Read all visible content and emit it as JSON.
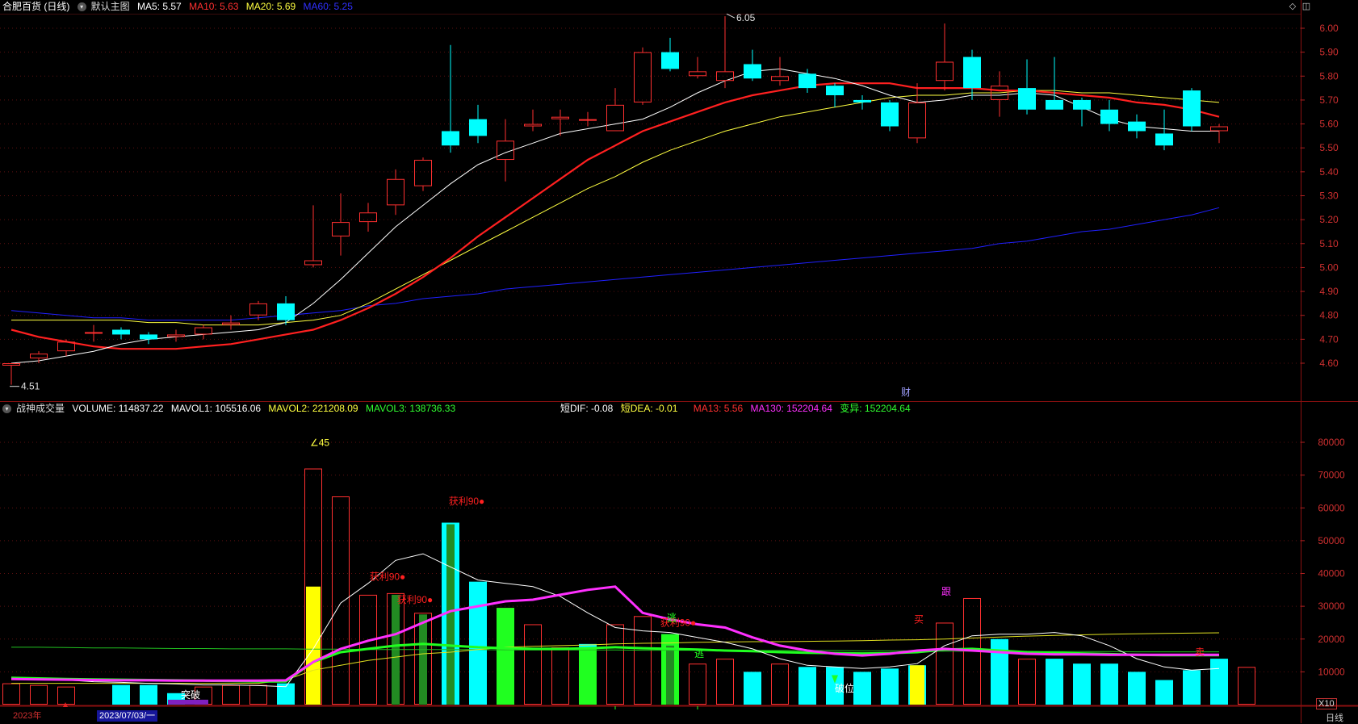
{
  "main_header": {
    "title": "合肥百货 (日线)",
    "formula": "默认主图",
    "ma5": "MA5: 5.57",
    "ma10": "MA10: 5.63",
    "ma20": "MA20: 5.69",
    "ma60": "MA60: 5.25"
  },
  "sub_header": {
    "title": "战神成交量",
    "volume": "VOLUME: 114837.22",
    "mavol1": "MAVOL1: 105516.06",
    "mavol2": "MAVOL2: 221208.09",
    "mavol3": "MAVOL3: 138736.33",
    "dif": "短DIF: -0.08",
    "dea": "短DEA: -0.01",
    "ma13": "MA13: 5.56",
    "ma130": "MA130: 152204.64",
    "change": "变异: 152204.64"
  },
  "colors": {
    "up": "#ff3030",
    "down": "#00ffff",
    "ma5": "#ffffff",
    "ma10": "#ff2020",
    "ma20": "#ffff40",
    "ma60": "#2020ff",
    "purple": "#ff30ff",
    "green": "#20ff20",
    "yellow": "#ffff00",
    "darkgreen": "#228b22"
  },
  "price_axis": [
    "6.00",
    "5.90",
    "5.80",
    "5.70",
    "5.60",
    "5.50",
    "5.40",
    "5.30",
    "5.20",
    "5.10",
    "5.00",
    "4.90",
    "4.80",
    "4.70",
    "4.60"
  ],
  "volume_axis": [
    "80000",
    "70000",
    "60000",
    "50000",
    "40000",
    "30000",
    "20000",
    "10000"
  ],
  "annotations": {
    "high": "6.05",
    "low": "4.51",
    "cai": "财",
    "ratio": "X10",
    "period": "日线",
    "vol_peak": "∠45",
    "year": "2023年",
    "date": "2023/07/03/一"
  },
  "signals": [
    {
      "text": "获利90●",
      "color": "#ff2020"
    },
    {
      "text": "获利90●",
      "color": "#ff2020"
    },
    {
      "text": "获利90●",
      "color": "#ff2020"
    },
    {
      "text": "获利90●",
      "color": "#ff2020"
    },
    {
      "text": "逃",
      "color": "#20ff20"
    },
    {
      "text": "逃",
      "color": "#20ff20"
    },
    {
      "text": "买",
      "color": "#ff2020"
    },
    {
      "text": "跟",
      "color": "#ff30ff"
    },
    {
      "text": "突破",
      "color": "#ffffff"
    },
    {
      "text": "破位",
      "color": "#ffffff"
    },
    {
      "text": "卖",
      "color": "#ff2020"
    }
  ],
  "chart_data": {
    "type": "candlestick",
    "candles": [
      {
        "o": 4.59,
        "c": 4.6,
        "h": 4.6,
        "l": 4.51
      },
      {
        "o": 4.62,
        "c": 4.64,
        "h": 4.65,
        "l": 4.6
      },
      {
        "o": 4.65,
        "c": 4.69,
        "h": 4.7,
        "l": 4.63
      },
      {
        "o": 4.73,
        "c": 4.73,
        "h": 4.76,
        "l": 4.69
      },
      {
        "o": 4.74,
        "c": 4.72,
        "h": 4.75,
        "l": 4.7
      },
      {
        "o": 4.72,
        "c": 4.7,
        "h": 4.73,
        "l": 4.68
      },
      {
        "o": 4.71,
        "c": 4.72,
        "h": 4.74,
        "l": 4.69
      },
      {
        "o": 4.72,
        "c": 4.75,
        "h": 4.76,
        "l": 4.7
      },
      {
        "o": 4.76,
        "c": 4.77,
        "h": 4.8,
        "l": 4.74
      },
      {
        "o": 4.8,
        "c": 4.85,
        "h": 4.86,
        "l": 4.78
      },
      {
        "o": 4.85,
        "c": 4.78,
        "h": 4.88,
        "l": 4.76
      },
      {
        "o": 5.01,
        "c": 5.03,
        "h": 5.26,
        "l": 5.0
      },
      {
        "o": 5.13,
        "c": 5.19,
        "h": 5.31,
        "l": 5.05
      },
      {
        "o": 5.19,
        "c": 5.23,
        "h": 5.27,
        "l": 5.15
      },
      {
        "o": 5.26,
        "c": 5.37,
        "h": 5.41,
        "l": 5.22
      },
      {
        "o": 5.34,
        "c": 5.45,
        "h": 5.46,
        "l": 5.32
      },
      {
        "o": 5.57,
        "c": 5.51,
        "h": 5.93,
        "l": 5.48
      },
      {
        "o": 5.62,
        "c": 5.55,
        "h": 5.68,
        "l": 5.52
      },
      {
        "o": 5.45,
        "c": 5.53,
        "h": 5.62,
        "l": 5.36
      },
      {
        "o": 5.59,
        "c": 5.6,
        "h": 5.66,
        "l": 5.57
      },
      {
        "o": 5.62,
        "c": 5.63,
        "h": 5.66,
        "l": 5.55
      },
      {
        "o": 5.62,
        "c": 5.62,
        "h": 5.65,
        "l": 5.59
      },
      {
        "o": 5.57,
        "c": 5.68,
        "h": 5.75,
        "l": 5.57
      },
      {
        "o": 5.69,
        "c": 5.9,
        "h": 5.92,
        "l": 5.68
      },
      {
        "o": 5.9,
        "c": 5.83,
        "h": 5.96,
        "l": 5.82
      },
      {
        "o": 5.8,
        "c": 5.82,
        "h": 5.88,
        "l": 5.79
      },
      {
        "o": 5.78,
        "c": 5.82,
        "h": 6.05,
        "l": 5.75
      },
      {
        "o": 5.85,
        "c": 5.79,
        "h": 5.91,
        "l": 5.78
      },
      {
        "o": 5.78,
        "c": 5.8,
        "h": 5.88,
        "l": 5.76
      },
      {
        "o": 5.81,
        "c": 5.75,
        "h": 5.83,
        "l": 5.73
      },
      {
        "o": 5.76,
        "c": 5.72,
        "h": 5.77,
        "l": 5.67
      },
      {
        "o": 5.7,
        "c": 5.69,
        "h": 5.72,
        "l": 5.66
      },
      {
        "o": 5.69,
        "c": 5.59,
        "h": 5.7,
        "l": 5.57
      },
      {
        "o": 5.54,
        "c": 5.69,
        "h": 5.77,
        "l": 5.52
      },
      {
        "o": 5.78,
        "c": 5.86,
        "h": 6.02,
        "l": 5.74
      },
      {
        "o": 5.88,
        "c": 5.75,
        "h": 5.91,
        "l": 5.7
      },
      {
        "o": 5.7,
        "c": 5.76,
        "h": 5.82,
        "l": 5.63
      },
      {
        "o": 5.75,
        "c": 5.66,
        "h": 5.87,
        "l": 5.64
      },
      {
        "o": 5.7,
        "c": 5.66,
        "h": 5.88,
        "l": 5.66
      },
      {
        "o": 5.7,
        "c": 5.66,
        "h": 5.71,
        "l": 5.59
      },
      {
        "o": 5.66,
        "c": 5.6,
        "h": 5.7,
        "l": 5.57
      },
      {
        "o": 5.61,
        "c": 5.57,
        "h": 5.64,
        "l": 5.54
      },
      {
        "o": 5.56,
        "c": 5.51,
        "h": 5.66,
        "l": 5.49
      },
      {
        "o": 5.74,
        "c": 5.59,
        "h": 5.75,
        "l": 5.57
      },
      {
        "o": 5.57,
        "c": 5.59,
        "h": 5.6,
        "l": 5.52
      }
    ],
    "ma5": [
      4.6,
      4.61,
      4.63,
      4.65,
      4.68,
      4.7,
      4.71,
      4.72,
      4.73,
      4.74,
      4.77,
      4.85,
      4.95,
      5.06,
      5.17,
      5.26,
      5.35,
      5.43,
      5.48,
      5.52,
      5.56,
      5.58,
      5.6,
      5.62,
      5.67,
      5.73,
      5.78,
      5.82,
      5.83,
      5.81,
      5.79,
      5.76,
      5.72,
      5.69,
      5.7,
      5.72,
      5.72,
      5.73,
      5.72,
      5.67,
      5.62,
      5.59,
      5.58,
      5.57,
      5.57
    ],
    "ma10": [
      4.74,
      4.71,
      4.69,
      4.67,
      4.66,
      4.66,
      4.66,
      4.67,
      4.68,
      4.7,
      4.72,
      4.74,
      4.78,
      4.83,
      4.89,
      4.96,
      5.04,
      5.13,
      5.21,
      5.29,
      5.37,
      5.45,
      5.51,
      5.57,
      5.61,
      5.65,
      5.69,
      5.72,
      5.74,
      5.76,
      5.77,
      5.77,
      5.77,
      5.75,
      5.75,
      5.75,
      5.74,
      5.74,
      5.73,
      5.72,
      5.71,
      5.69,
      5.68,
      5.66,
      5.63
    ],
    "ma20": [
      4.78,
      4.78,
      4.78,
      4.78,
      4.78,
      4.77,
      4.77,
      4.76,
      4.76,
      4.76,
      4.77,
      4.78,
      4.8,
      4.85,
      4.91,
      4.97,
      5.03,
      5.09,
      5.15,
      5.21,
      5.27,
      5.33,
      5.38,
      5.44,
      5.49,
      5.53,
      5.57,
      5.6,
      5.63,
      5.65,
      5.67,
      5.69,
      5.71,
      5.72,
      5.72,
      5.73,
      5.73,
      5.74,
      5.74,
      5.73,
      5.73,
      5.72,
      5.71,
      5.7,
      5.69
    ],
    "ma60": [
      4.82,
      4.81,
      4.8,
      4.79,
      4.79,
      4.78,
      4.78,
      4.78,
      4.78,
      4.79,
      4.8,
      4.81,
      4.82,
      4.84,
      4.85,
      4.87,
      4.88,
      4.89,
      4.91,
      4.92,
      4.93,
      4.94,
      4.95,
      4.96,
      4.97,
      4.98,
      4.99,
      5.0,
      5.01,
      5.02,
      5.03,
      5.04,
      5.05,
      5.06,
      5.07,
      5.08,
      5.1,
      5.11,
      5.13,
      5.15,
      5.16,
      5.18,
      5.2,
      5.22,
      5.25
    ],
    "volume": [
      6500,
      6000,
      5500,
      0,
      6000,
      6000,
      3500,
      5500,
      6000,
      6000,
      6500,
      72000,
      63500,
      33500,
      34000,
      28000,
      55500,
      37500,
      29500,
      24500,
      17500,
      18500,
      24500,
      27000,
      21500,
      12500,
      14000,
      10000,
      12500,
      11500,
      11500,
      10000,
      11000,
      12000,
      25000,
      32500,
      20000,
      14000,
      14000,
      12500,
      12500,
      10000,
      7500,
      10500,
      14000,
      11500
    ],
    "vol_color": [
      "u",
      "u",
      "u",
      "u",
      "d",
      "d",
      "d",
      "u",
      "u",
      "u",
      "d",
      "u",
      "u",
      "u",
      "u",
      "u",
      "d",
      "d",
      "u",
      "u",
      "u",
      "d",
      "u",
      "u",
      "d",
      "u",
      "u",
      "d",
      "u",
      "d",
      "d",
      "d",
      "d",
      "d",
      "u",
      "u",
      "d",
      "u",
      "d",
      "d",
      "d",
      "d",
      "d",
      "d",
      "d",
      "u"
    ],
    "vol_inner": [
      {
        "i": 11,
        "v": 36000,
        "c": "yellow"
      },
      {
        "i": 14,
        "v": 33500,
        "c": "darkgreen"
      },
      {
        "i": 15,
        "v": 27500,
        "c": "darkgreen"
      },
      {
        "i": 16,
        "v": 55000,
        "c": "darkgreen"
      },
      {
        "i": 18,
        "v": 29500,
        "c": "green"
      },
      {
        "i": 21,
        "v": 17500,
        "c": "green"
      },
      {
        "i": 24,
        "v": 21500,
        "c": "green"
      },
      {
        "i": 24,
        "v": 18000,
        "c": "darkgreen"
      },
      {
        "i": 33,
        "v": 12000,
        "c": "yellow"
      }
    ],
    "vol_line_white": [
      8000,
      7500,
      7500,
      7000,
      6800,
      6500,
      6300,
      6000,
      6000,
      5800,
      5500,
      17000,
      31000,
      37000,
      44000,
      46000,
      42000,
      38000,
      37000,
      36000,
      33000,
      28000,
      23500,
      22500,
      22000,
      20500,
      19000,
      17000,
      14000,
      12000,
      11500,
      11000,
      11500,
      12500,
      18000,
      21000,
      21500,
      21500,
      22000,
      21000,
      18000,
      14000,
      11500,
      10500,
      11000
    ],
    "vol_line_purple": [
      7800,
      7700,
      7600,
      7500,
      7400,
      7400,
      7300,
      7300,
      7300,
      7300,
      7400,
      13000,
      17000,
      19500,
      21500,
      25000,
      28500,
      30000,
      31500,
      32000,
      33500,
      35000,
      36000,
      28000,
      26000,
      24500,
      23500,
      20500,
      18000,
      16500,
      15500,
      15000,
      15500,
      16500,
      17000,
      16500,
      16000,
      15500,
      15300,
      15300,
      15200,
      15200,
      15200,
      15200,
      15200
    ],
    "vol_line_green_thin": [
      17500,
      17500,
      17400,
      17300,
      17300,
      17200,
      17100,
      17100,
      17000,
      17000,
      17000,
      16900,
      16900,
      16800,
      16800,
      16800,
      16800,
      16800,
      16700,
      16700,
      16700,
      16700,
      16700,
      16600,
      16600,
      16600,
      16600,
      16500,
      16500,
      16500,
      16500,
      16400,
      16400,
      16400,
      16300,
      16300,
      16300,
      16200,
      16200,
      16200,
      16200,
      16100,
      16100,
      16100,
      16100
    ],
    "vol_line_yellow": [
      6500,
      6500,
      6500,
      6500,
      6500,
      6500,
      6500,
      6500,
      6500,
      6500,
      7500,
      10500,
      12000,
      13500,
      14500,
      15500,
      16000,
      16800,
      17500,
      17800,
      18000,
      18200,
      18500,
      18700,
      18800,
      19000,
      19100,
      19200,
      19200,
      19300,
      19400,
      19500,
      19700,
      19800,
      20000,
      20300,
      20600,
      20900,
      21100,
      21300,
      21500,
      21600,
      21700,
      21800,
      21900
    ],
    "vol_line_green_thick": [
      8200,
      8000,
      7800,
      7700,
      7600,
      7500,
      7400,
      7300,
      7200,
      7100,
      7100,
      13000,
      16000,
      17000,
      18000,
      18500,
      18000,
      17500,
      17200,
      17000,
      17000,
      17200,
      17500,
      17200,
      17000,
      16800,
      16500,
      16300,
      16000,
      15800,
      15700,
      15600,
      15700,
      16000,
      16800,
      17000,
      16500,
      16000,
      15800,
      15600,
      15400,
      15200,
      15100,
      15100,
      15100
    ]
  }
}
